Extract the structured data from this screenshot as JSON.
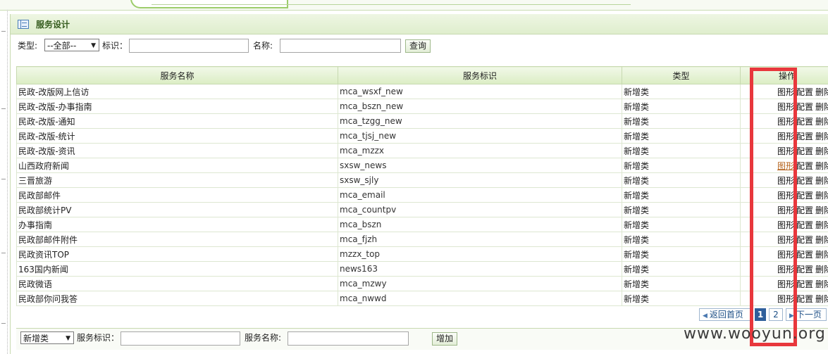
{
  "panel": {
    "title": "服务设计"
  },
  "search": {
    "type_label": "类型:",
    "type_value": "--全部--",
    "id_label": "标识：",
    "id_value": "",
    "name_label": "名称:",
    "name_value": "",
    "query_label": "查询"
  },
  "table": {
    "headers": [
      "服务名称",
      "服务标识",
      "类型",
      "操作"
    ],
    "op_labels": {
      "graph": "图形",
      "config": "配置",
      "delete": "删除"
    },
    "rows": [
      {
        "name": "民政-改版网上信访",
        "id": "mca_wsxf_new",
        "type": "新增类"
      },
      {
        "name": "民政-改版-办事指南",
        "id": "mca_bszn_new",
        "type": "新增类"
      },
      {
        "name": "民政-改版-通知",
        "id": "mca_tzgg_new",
        "type": "新增类"
      },
      {
        "name": "民政-改版-统计",
        "id": "mca_tjsj_new",
        "type": "新增类"
      },
      {
        "name": "民政-改版-资讯",
        "id": "mca_mzzx",
        "type": "新增类"
      },
      {
        "name": "山西政府新闻",
        "id": "sxsw_news",
        "type": "新增类"
      },
      {
        "name": "三晋旅游",
        "id": "sxsw_sjly",
        "type": "新增类"
      },
      {
        "name": "民政部邮件",
        "id": "mca_email",
        "type": "新增类"
      },
      {
        "name": "民政部统计PV",
        "id": "mca_countpv",
        "type": "新增类"
      },
      {
        "name": "办事指南",
        "id": "mca_bszn",
        "type": "新增类"
      },
      {
        "name": "民政部邮件附件",
        "id": "mca_fjzh",
        "type": "新增类"
      },
      {
        "name": "民政资讯TOP",
        "id": "mzzx_top",
        "type": "新增类"
      },
      {
        "name": "163国内新闻",
        "id": "news163",
        "type": "新增类"
      },
      {
        "name": "民政微语",
        "id": "mca_mzwy",
        "type": "新增类"
      },
      {
        "name": "民政部你问我答",
        "id": "mca_nwwd",
        "type": "新增类"
      }
    ]
  },
  "pager": {
    "first": "返回首页",
    "page1": "1",
    "page2": "2",
    "next": "下一页"
  },
  "add_bar": {
    "type_value": "新增类",
    "id_label": "服务标识：",
    "id_value": "",
    "name_label": "服务名称:",
    "name_value": "",
    "add_label": "增加"
  },
  "watermark": "www.wooyun.org",
  "colors": {
    "accent_green": "#dbedc4",
    "annotation_red": "#e8373c",
    "pager_blue": "#2f5f9b"
  }
}
